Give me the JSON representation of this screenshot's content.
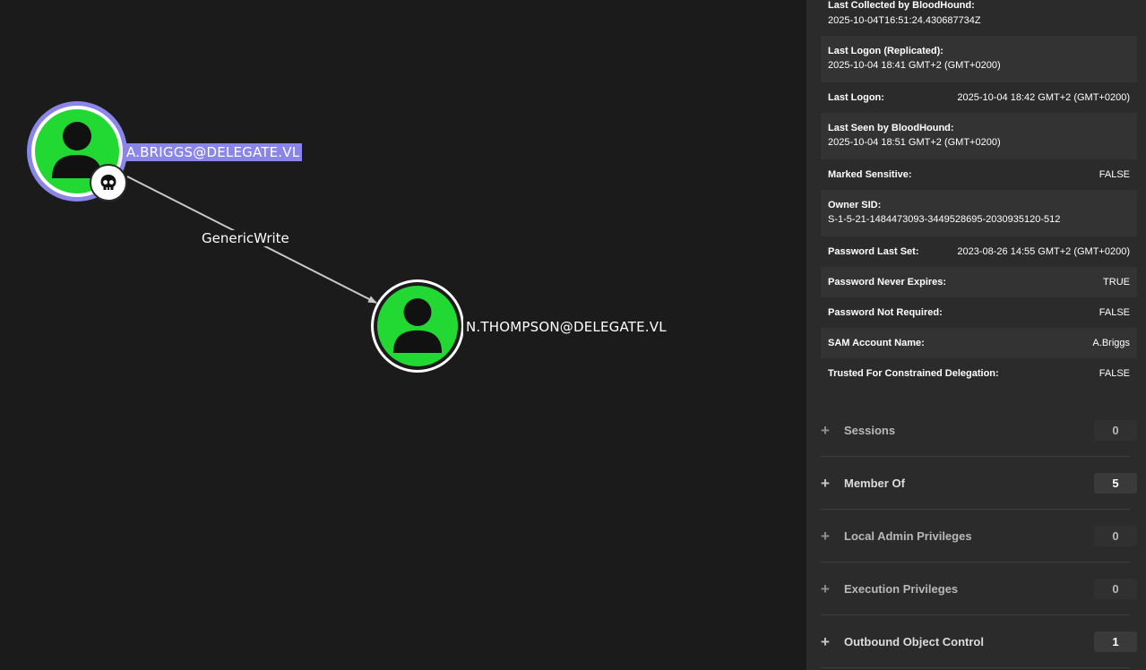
{
  "graph": {
    "nodes": [
      {
        "id": "abriggs",
        "label": "A.BRIGGS@DELEGATE.VL",
        "selected": true,
        "badge": "skull-icon"
      },
      {
        "id": "nthompson",
        "label": "N.THOMPSON@DELEGATE.VL",
        "selected": false
      }
    ],
    "edge": {
      "label": "GenericWrite"
    },
    "colors": {
      "node_fill": "#22d833",
      "selected_ring": "#8a85e8",
      "label_highlight": "#8a85e8",
      "edge": "#c8c8c8"
    }
  },
  "properties": [
    {
      "key": "Last Collected by BloodHound:",
      "value": "2025-10-04T16:51:24.430687734Z",
      "layout": "stacked"
    },
    {
      "key": "Last Logon (Replicated):",
      "value": "2025-10-04 18:41 GMT+2 (GMT+0200)",
      "layout": "stacked"
    },
    {
      "key": "Last Logon:",
      "value": "2025-10-04 18:42 GMT+2 (GMT+0200)",
      "layout": "inline"
    },
    {
      "key": "Last Seen by BloodHound:",
      "value": "2025-10-04 18:51 GMT+2 (GMT+0200)",
      "layout": "stacked"
    },
    {
      "key": "Marked Sensitive:",
      "value": "FALSE",
      "layout": "inline"
    },
    {
      "key": "Owner SID:",
      "value": "S-1-5-21-1484473093-3449528695-2030935120-512",
      "layout": "stacked"
    },
    {
      "key": "Password Last Set:",
      "value": "2023-08-26 14:55 GMT+2 (GMT+0200)",
      "layout": "inline"
    },
    {
      "key": "Password Never Expires:",
      "value": "TRUE",
      "layout": "inline"
    },
    {
      "key": "Password Not Required:",
      "value": "FALSE",
      "layout": "inline"
    },
    {
      "key": "SAM Account Name:",
      "value": "A.Briggs",
      "layout": "inline"
    },
    {
      "key": "Trusted For Constrained Delegation:",
      "value": "FALSE",
      "layout": "inline"
    }
  ],
  "sections": [
    {
      "label": "Sessions",
      "count": "0"
    },
    {
      "label": "Member Of",
      "count": "5"
    },
    {
      "label": "Local Admin Privileges",
      "count": "0"
    },
    {
      "label": "Execution Privileges",
      "count": "0"
    },
    {
      "label": "Outbound Object Control",
      "count": "1"
    }
  ]
}
